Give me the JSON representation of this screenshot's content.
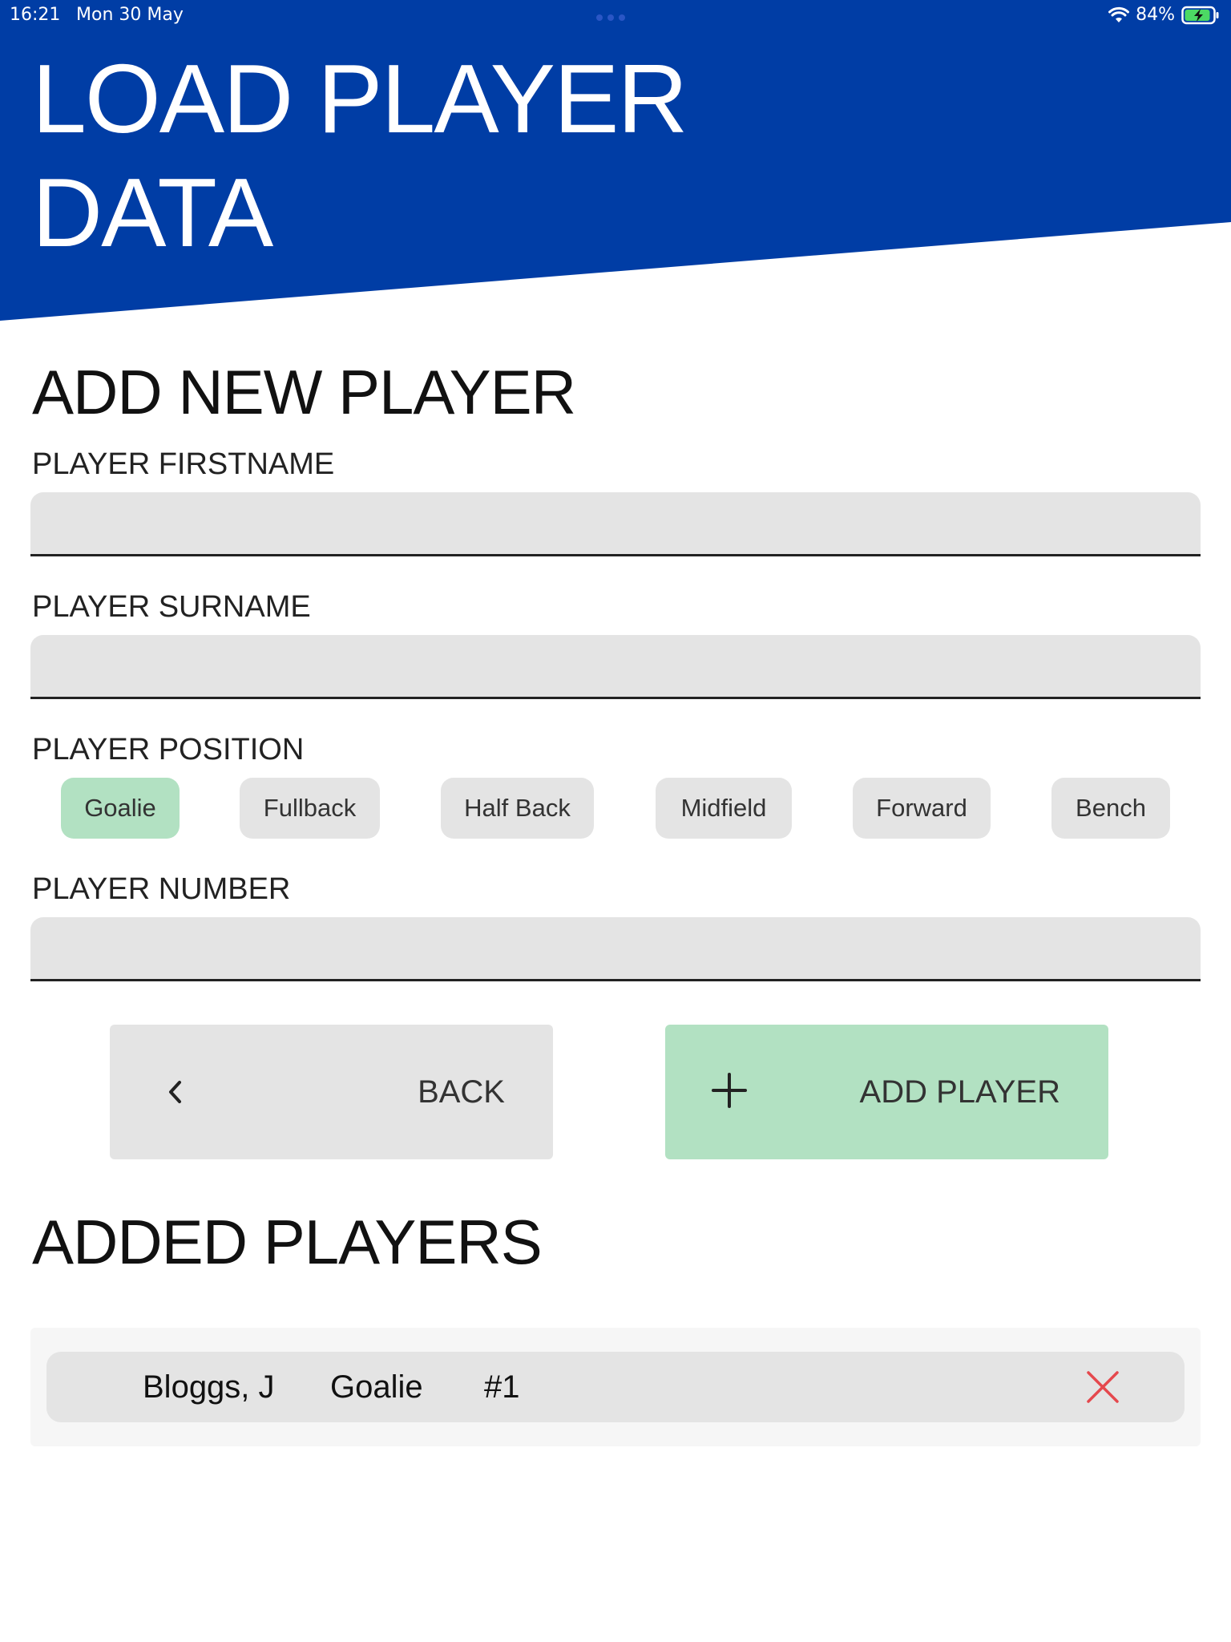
{
  "status_bar": {
    "time": "16:21",
    "date": "Mon 30 May",
    "battery_percent": "84%",
    "icons": [
      "wifi-icon",
      "battery-charging-icon"
    ]
  },
  "colors": {
    "brand_blue": "#003da5",
    "selected_green": "#b2e1c2",
    "control_grey": "#e4e4e4",
    "remove_red": "#e5484d"
  },
  "header": {
    "title": "LOAD PLAYER DATA"
  },
  "form": {
    "section_title": "ADD NEW PLAYER",
    "firstname_label": "PLAYER FIRSTNAME",
    "firstname_value": "",
    "surname_label": "PLAYER SURNAME",
    "surname_value": "",
    "position_label": "PLAYER POSITION",
    "positions": [
      "Goalie",
      "Fullback",
      "Half Back",
      "Midfield",
      "Forward",
      "Bench"
    ],
    "selected_position": "Goalie",
    "number_label": "PLAYER NUMBER",
    "number_value": ""
  },
  "actions": {
    "back_label": "BACK",
    "back_icon": "chevron-left-icon",
    "add_label": "ADD PLAYER",
    "add_icon": "plus-icon"
  },
  "added_players": {
    "section_title": "ADDED PLAYERS",
    "rows": [
      {
        "name": "Bloggs, J",
        "position": "Goalie",
        "number": "#1",
        "remove_icon": "close-icon"
      }
    ]
  }
}
